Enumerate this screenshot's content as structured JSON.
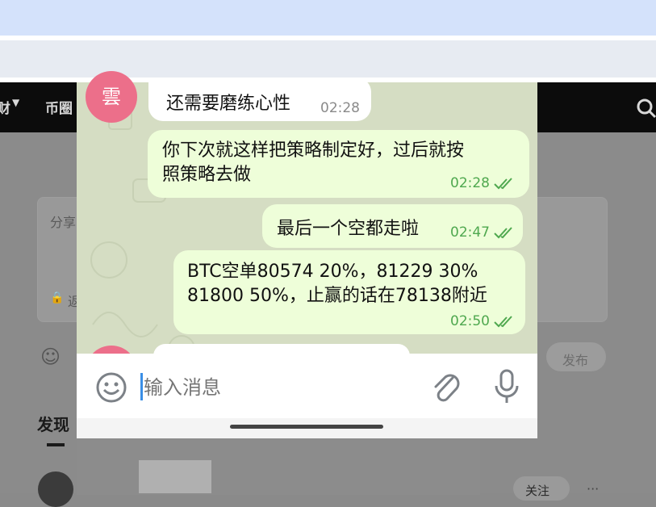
{
  "nav": {
    "items": [
      {
        "label": "财"
      },
      {
        "label": "币圈"
      }
    ]
  },
  "page": {
    "compose_placeholder": "分享",
    "compose_side_label": "返",
    "publish_label": "发布",
    "discover_label": "发现",
    "follow_label": "关注",
    "more_label": "···"
  },
  "chat": {
    "avatar_text": "雲",
    "messages": [
      {
        "direction": "in",
        "text": "还需要磨练心性",
        "time": "02:28"
      },
      {
        "direction": "out",
        "line1": "你下次就这样把策略制定好，过后就按",
        "line2": "照策略去做",
        "time": "02:28",
        "status": "read"
      },
      {
        "direction": "out",
        "text": "最后一个空都走啦",
        "time": "02:47",
        "status": "read"
      },
      {
        "direction": "out",
        "line1": "BTC空单80574 20%，81229 30%",
        "line2": "81800 50%，止赢的话在78138附近",
        "time": "02:50",
        "status": "read"
      }
    ],
    "input": {
      "placeholder": "输入消息"
    }
  },
  "colors": {
    "accent_green": "#4fa84f",
    "outgoing_bubble": "#eefed9",
    "chat_background": "#d5ddc3",
    "avatar": "#ec6f8a"
  }
}
